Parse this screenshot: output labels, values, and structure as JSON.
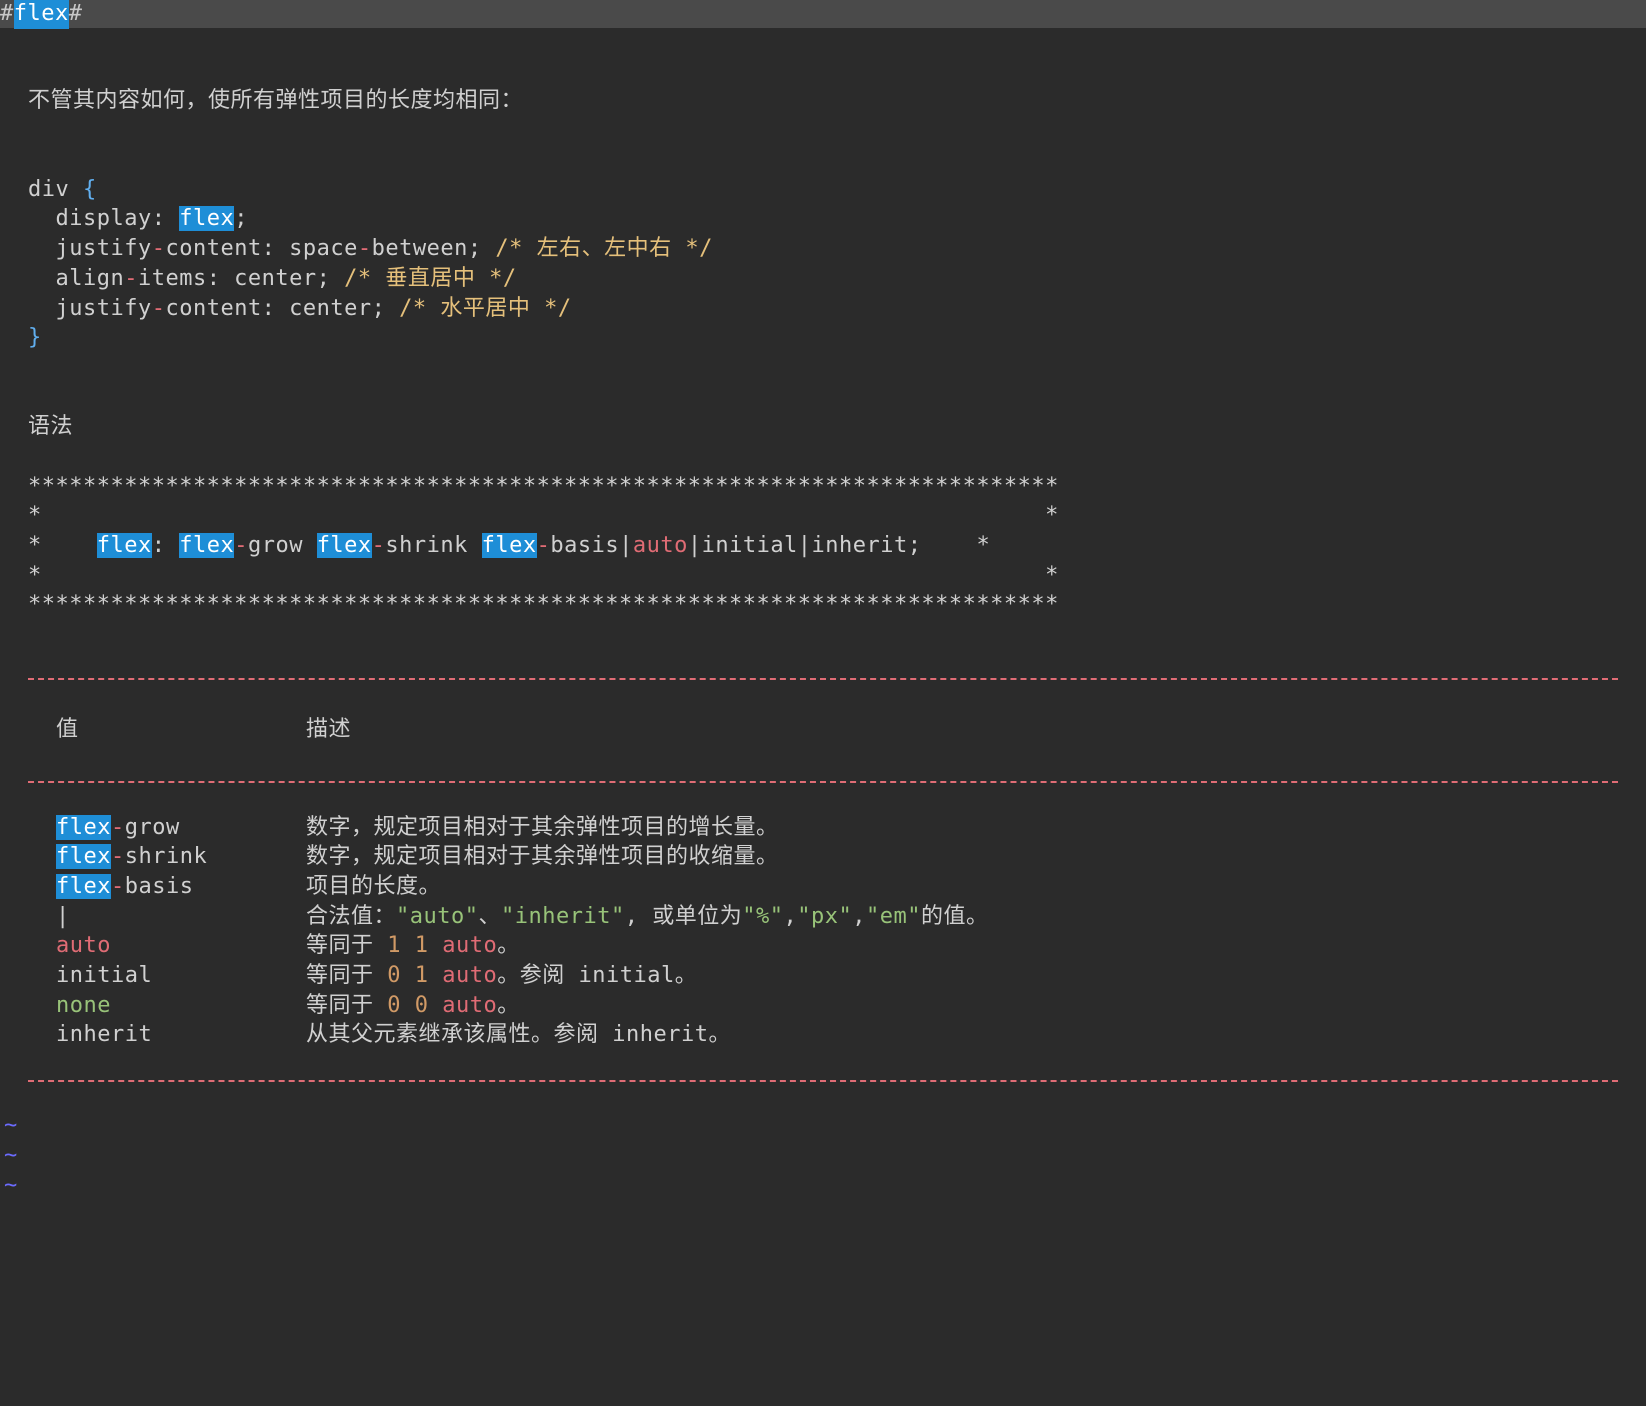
{
  "title": {
    "hash": "#",
    "word": "flex",
    "hash2": "#"
  },
  "intro": "不管其内容如何，使所有弹性项目的长度均相同：",
  "code": {
    "l1a": "div ",
    "l1b": "{",
    "l2a": "  display: ",
    "l2b": "flex",
    "l2c": ";",
    "l3a": "  justify",
    "l3b": "-",
    "l3c": "content: space",
    "l3d": "-",
    "l3e": "between; ",
    "l3f": "/* 左右、左中右 */",
    "l4a": "  align",
    "l4b": "-",
    "l4c": "items: center; ",
    "l4d": "/* 垂直居中 */",
    "l5a": "  justify",
    "l5b": "-",
    "l5c": "content: center; ",
    "l5d": "/* 水平居中 */",
    "l6": "}"
  },
  "syntax_label": "语法",
  "box": {
    "top": "***************************************************************************",
    "side": "*                                                                         *",
    "mid_pre": "*    ",
    "w_flex": "flex",
    "colon": ": ",
    "w_grow_a": "flex",
    "w_grow_b": "-",
    "w_grow_c": "grow ",
    "w_shrink_a": "flex",
    "w_shrink_b": "-",
    "w_shrink_c": "shrink ",
    "w_basis_a": "flex",
    "w_basis_b": "-",
    "w_basis_c": "basis",
    "pipe1": "|",
    "auto": "auto",
    "rest": "|initial|inherit;    *"
  },
  "table": {
    "h_value": "值",
    "h_desc": "描述",
    "rows": [
      {
        "v": [
          {
            "hl": "flex"
          },
          {
            "red": "-"
          },
          {
            "t": "grow"
          }
        ],
        "d": [
          {
            "t": "数字，规定项目相对于其余弹性项目的增长量。"
          }
        ]
      },
      {
        "v": [
          {
            "hl": "flex"
          },
          {
            "red": "-"
          },
          {
            "t": "shrink"
          }
        ],
        "d": [
          {
            "t": "数字，规定项目相对于其余弹性项目的收缩量。"
          }
        ]
      },
      {
        "v": [
          {
            "hl": "flex"
          },
          {
            "red": "-"
          },
          {
            "t": "basis"
          }
        ],
        "d": [
          {
            "t": "项目的长度。"
          }
        ]
      },
      {
        "v": [
          {
            "t": "|"
          }
        ],
        "d": [
          {
            "t": "合法值："
          },
          {
            "str": "\"auto\""
          },
          {
            "t": "、"
          },
          {
            "str": "\"inherit\""
          },
          {
            "t": ", 或单位为"
          },
          {
            "str": "\"%\""
          },
          {
            "t": ","
          },
          {
            "str": "\"px\""
          },
          {
            "t": ","
          },
          {
            "str": "\"em\""
          },
          {
            "t": "的值。"
          }
        ]
      },
      {
        "v": [
          {
            "red": "auto"
          }
        ],
        "d": [
          {
            "t": "等同于 "
          },
          {
            "or": "1 1"
          },
          {
            "t": " "
          },
          {
            "red": "auto"
          },
          {
            "t": "。"
          }
        ]
      },
      {
        "v": [
          {
            "t": "initial"
          }
        ],
        "d": [
          {
            "t": "等同于 "
          },
          {
            "or": "0 1"
          },
          {
            "t": " "
          },
          {
            "red": "auto"
          },
          {
            "t": "。参阅 initial。"
          }
        ]
      },
      {
        "v": [
          {
            "grn": "none"
          }
        ],
        "d": [
          {
            "t": "等同于 "
          },
          {
            "or": "0 0"
          },
          {
            "t": " "
          },
          {
            "red": "auto"
          },
          {
            "t": "。"
          }
        ]
      },
      {
        "v": [
          {
            "t": "inherit"
          }
        ],
        "d": [
          {
            "t": "从其父元素继承该属性。参阅 inherit。"
          }
        ]
      }
    ]
  },
  "tildes": [
    "~",
    "~",
    "~"
  ]
}
